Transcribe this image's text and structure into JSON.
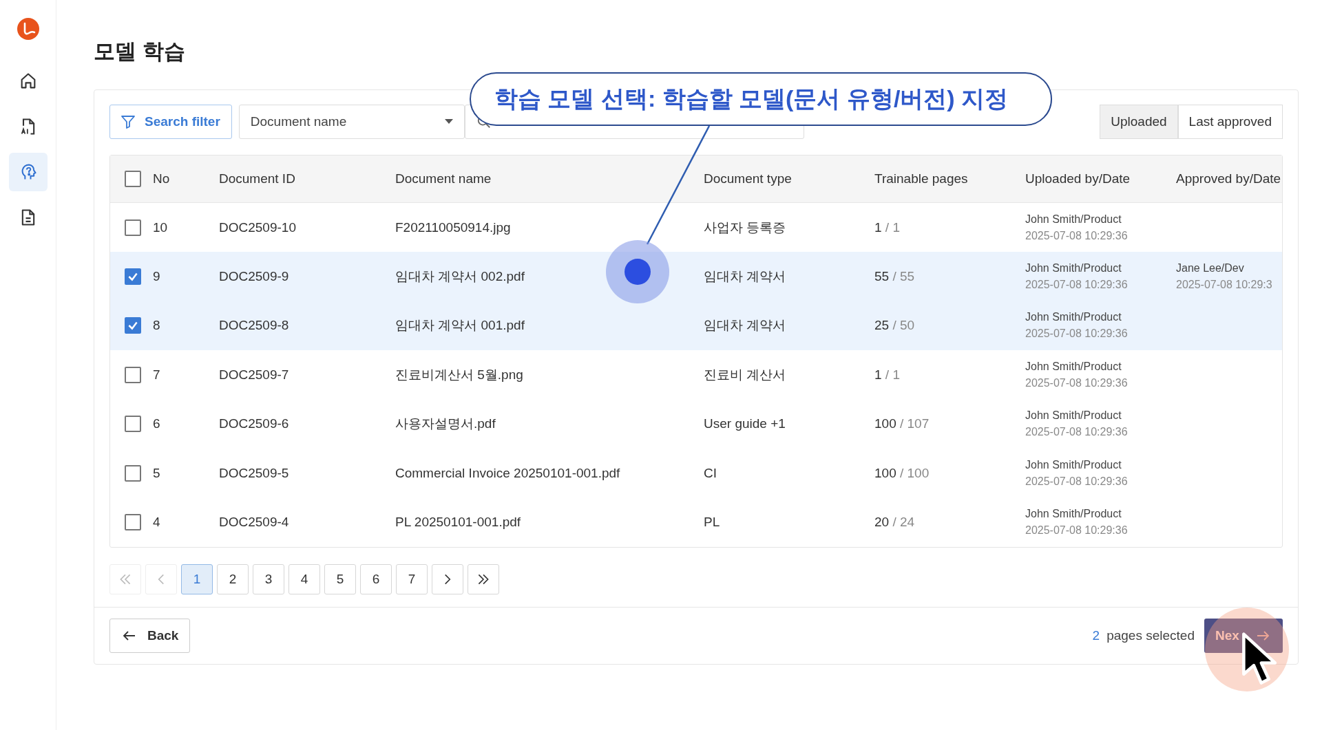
{
  "sidebar": {
    "items": [
      {
        "kind": "home",
        "selected": false
      },
      {
        "kind": "ai-doc",
        "selected": false
      },
      {
        "kind": "brain",
        "selected": true
      },
      {
        "kind": "doc",
        "selected": false
      }
    ]
  },
  "page_title": "모델 학습",
  "toolbar": {
    "filter_button": "Search filter",
    "select": {
      "value": "Document name"
    },
    "toggles": [
      {
        "label": "Uploaded",
        "selected": true
      },
      {
        "label": "Last approved",
        "selected": false
      }
    ]
  },
  "callout": "학습 모델 선택: 학습할 모델(문서 유형/버전) 지정",
  "table": {
    "header_checked": false,
    "columns": [
      "No",
      "Document ID",
      "Document name",
      "Document type",
      "Trainable pages",
      "Uploaded by/Date",
      "Approved by/Date"
    ],
    "rows": [
      {
        "selected": false,
        "no": "10",
        "id": "DOC2509-10",
        "name": "F202110050914.jpg",
        "type": "사업자 등록증",
        "pages": "**1** / 1",
        "uploaded_by": "John Smith/Product",
        "uploaded_date": "2025-07-08 10:29:36"
      },
      {
        "selected": true,
        "no": "9",
        "id": "DOC2509-9",
        "name": "임대차 계약서 002.pdf",
        "type": "임대차 계약서",
        "pages": "**55** / 55",
        "uploaded_by": "John Smith/Product",
        "uploaded_date": "2025-07-08 10:29:36",
        "approved_by": "Jane Lee/Dev",
        "approved_date": "2025-07-08 10:29:3"
      },
      {
        "selected": true,
        "no": "8",
        "id": "DOC2509-8",
        "name": "임대차 계약서 001.pdf",
        "type": "임대차 계약서",
        "pages": "**25** / 50",
        "uploaded_by": "John Smith/Product",
        "uploaded_date": "2025-07-08 10:29:36"
      },
      {
        "selected": false,
        "no": "7",
        "id": "DOC2509-7",
        "name": "진료비계산서 5월.png",
        "type": "진료비 계산서",
        "pages": "**1** / 1",
        "uploaded_by": "John Smith/Product",
        "uploaded_date": "2025-07-08 10:29:36"
      },
      {
        "selected": false,
        "no": "6",
        "id": "DOC2509-6",
        "name": "사용자설명서.pdf",
        "type": "User guide +1",
        "pages": "**100** / 107",
        "uploaded_by": "John Smith/Product",
        "uploaded_date": "2025-07-08 10:29:36"
      },
      {
        "selected": false,
        "no": "5",
        "id": "DOC2509-5",
        "name": "Commercial Invoice 20250101-001.pdf",
        "type": "CI",
        "pages": "**100** / 100",
        "uploaded_by": "John Smith/Product",
        "uploaded_date": "2025-07-08 10:29:36"
      },
      {
        "selected": false,
        "no": "4",
        "id": "DOC2509-4",
        "name": "PL 20250101-001.pdf",
        "type": "PL",
        "pages": "**20** / 24",
        "uploaded_by": "John Smith/Product",
        "uploaded_date": "2025-07-08 10:29:36"
      }
    ]
  },
  "pagination": {
    "first": {
      "disabled": true
    },
    "prev": {
      "disabled": true
    },
    "pages": [
      {
        "label": "1",
        "selected": true
      },
      {
        "label": "2",
        "selected": false
      },
      {
        "label": "3",
        "selected": false
      },
      {
        "label": "4",
        "selected": false
      },
      {
        "label": "5",
        "selected": false
      },
      {
        "label": "6",
        "selected": false
      },
      {
        "label": "7",
        "selected": false
      }
    ],
    "next": {
      "disabled": false
    },
    "last": {
      "disabled": false
    }
  },
  "footer": {
    "back_button": "Back",
    "selected_count": "2",
    "selected_label": "pages selected",
    "next_button": "Nex"
  }
}
